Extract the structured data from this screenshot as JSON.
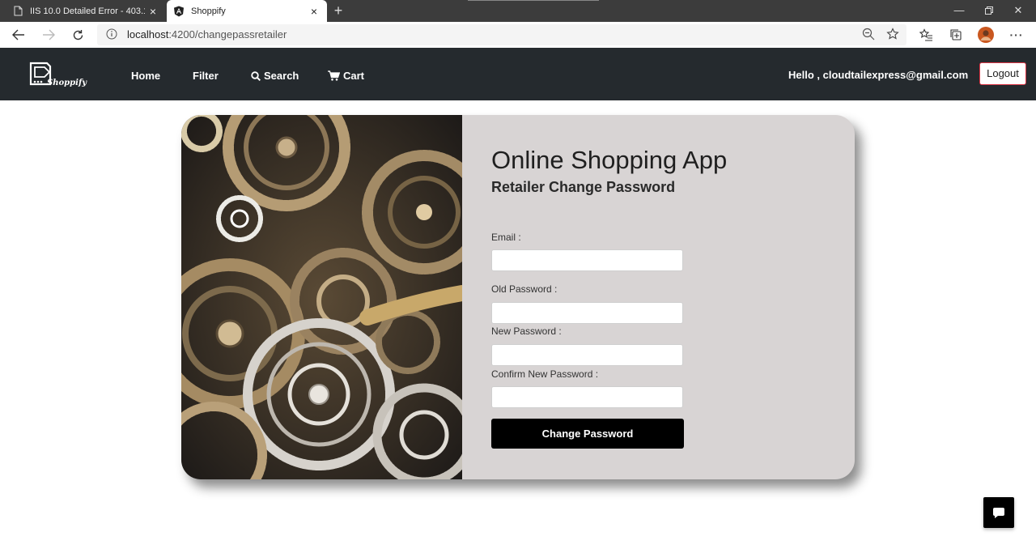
{
  "browser": {
    "tabs": [
      {
        "title": "IIS 10.0 Detailed Error - 403.14 -",
        "icon": "page-icon",
        "active": false
      },
      {
        "title": "Shoppify",
        "icon": "angular-icon",
        "active": true
      }
    ],
    "url_host": "localhost",
    "url_path": ":4200/changepassretailer"
  },
  "nav": {
    "brand": "Shoppify",
    "links": [
      {
        "label": "Home",
        "icon": ""
      },
      {
        "label": "Filter",
        "icon": ""
      },
      {
        "label": "Search",
        "icon": "search-icon"
      },
      {
        "label": "Cart",
        "icon": "cart-icon"
      }
    ],
    "greeting": "Hello , cloudtailexpress@gmail.com",
    "logout": "Logout"
  },
  "form": {
    "title": "Online Shopping App",
    "subtitle": "Retailer Change Password",
    "fields": [
      {
        "label": "Email :",
        "value": "",
        "placeholder": ""
      },
      {
        "label": "Old Password :",
        "value": "",
        "placeholder": ""
      },
      {
        "label": "New Password :",
        "value": "",
        "placeholder": ""
      },
      {
        "label": "Confirm New Password :",
        "value": "",
        "placeholder": ""
      }
    ],
    "submit": "Change Password"
  },
  "colors": {
    "navbar": "#252a2e",
    "card": "#d8d4d4",
    "button": "#000000",
    "logout_border": "#dc3545"
  }
}
